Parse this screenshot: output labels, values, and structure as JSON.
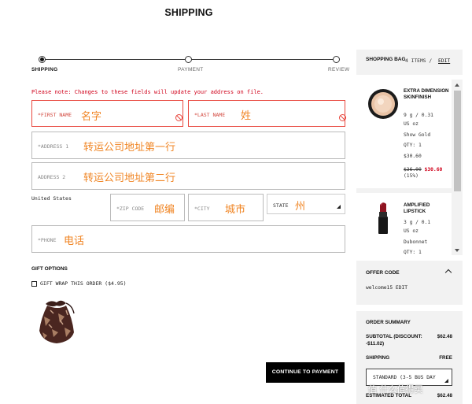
{
  "header": {
    "title": "SHIPPING"
  },
  "progress": {
    "steps": [
      {
        "label": "SHIPPING",
        "active": true
      },
      {
        "label": "PAYMENT",
        "active": false
      },
      {
        "label": "REVIEW",
        "active": false
      }
    ]
  },
  "form": {
    "note": "Please note: Changes to these fields will update your address on file.",
    "first_name": {
      "label": "*FIRST NAME",
      "value": "名字"
    },
    "last_name": {
      "label": "*LAST NAME",
      "value": "姓"
    },
    "address1": {
      "label": "*ADDRESS 1",
      "value": "转运公司地址第一行"
    },
    "address2": {
      "label": "ADDRESS 2",
      "value": "转运公司地址第二行"
    },
    "country": "United States",
    "zip": {
      "label": "*ZIP CODE",
      "value": "邮编"
    },
    "city": {
      "label": "*CITY",
      "value": "城市"
    },
    "state": {
      "label": "STATE",
      "value": "州"
    },
    "phone": {
      "label": "*PHONE",
      "value": "电话"
    }
  },
  "gift": {
    "title": "GIFT OPTIONS",
    "wrap_label": "GIFT WRAP THIS ORDER ($4.95)"
  },
  "continue_label": "CONTINUE TO PAYMENT",
  "bag": {
    "title": "SHOPPING BAG",
    "count": "4 ITEMS /",
    "edit": "EDIT",
    "items": [
      {
        "name": "EXTRA DIMENSION SKINFINISH",
        "size": "9 g / 0.31",
        "unit": "US oz",
        "shade": "Show Gold",
        "qty": "QTY: 1",
        "price": "$30.60",
        "orig_price": "$36.00",
        "sale_price": "$30.60",
        "discount": "(15%)"
      },
      {
        "name": "AMPLIFIED LIPSTICK",
        "size": "3 g / 0.1",
        "unit": "US oz",
        "shade": "Dubonnet",
        "qty": "QTY: 1"
      }
    ]
  },
  "offer": {
    "title": "OFFER CODE",
    "code": "welcome15 EDIT"
  },
  "summary": {
    "title": "ORDER SUMMARY",
    "subtotal_label_1": "SUBTOTAL (DISCOUNT:",
    "subtotal_label_2": "-$11.02)",
    "subtotal_value": "$62.48",
    "shipping_label": "SHIPPING",
    "shipping_value": "FREE",
    "shipping_option": "STANDARD (3-5 BUS DAY",
    "total_label": "ESTIMATED TOTAL",
    "total_value": "$62.48"
  },
  "watermark": "值 什么值得买",
  "colors": {
    "error": "#d0021b",
    "input_text": "#f08524",
    "panel_bg": "#f2f2f2",
    "button": "#000000"
  }
}
